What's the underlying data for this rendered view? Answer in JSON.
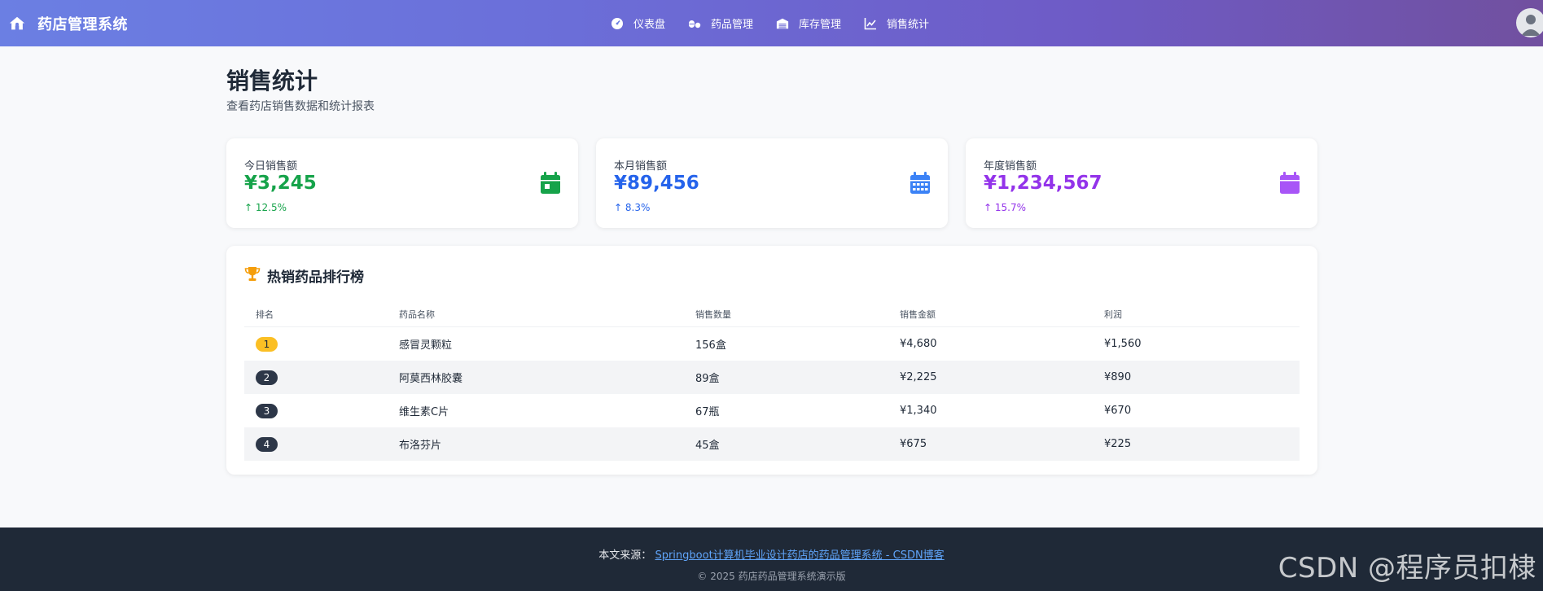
{
  "app": {
    "title": "药店管理系统"
  },
  "nav": {
    "items": [
      {
        "label": "仪表盘",
        "icon": "dashboard-icon"
      },
      {
        "label": "药品管理",
        "icon": "pills-icon"
      },
      {
        "label": "库存管理",
        "icon": "warehouse-icon"
      },
      {
        "label": "销售统计",
        "icon": "chart-line-icon"
      }
    ]
  },
  "page": {
    "title": "销售统计",
    "subtitle": "查看药店销售数据和统计报表"
  },
  "stats": [
    {
      "label": "今日销售额",
      "value": "¥3,245",
      "change": "↑ 12.5%",
      "color": "#16a34a",
      "icon": "calendar-day-icon"
    },
    {
      "label": "本月销售额",
      "value": "¥89,456",
      "change": "↑ 8.3%",
      "color": "#2563eb",
      "icon": "calendar-month-icon"
    },
    {
      "label": "年度销售额",
      "value": "¥1,234,567",
      "change": "↑ 15.7%",
      "color": "#9333ea",
      "icon": "calendar-year-icon"
    }
  ],
  "ranking": {
    "title": "热销药品排行榜",
    "columns": [
      "排名",
      "药品名称",
      "销售数量",
      "销售金额",
      "利润"
    ],
    "rows": [
      {
        "rank": "1",
        "name": "感冒灵颗粒",
        "qty": "156盒",
        "amount": "¥4,680",
        "profit": "¥1,560"
      },
      {
        "rank": "2",
        "name": "阿莫西林胶囊",
        "qty": "89盒",
        "amount": "¥2,225",
        "profit": "¥890"
      },
      {
        "rank": "3",
        "name": "维生素C片",
        "qty": "67瓶",
        "amount": "¥1,340",
        "profit": "¥670"
      },
      {
        "rank": "4",
        "name": "布洛芬片",
        "qty": "45盒",
        "amount": "¥675",
        "profit": "¥225"
      }
    ]
  },
  "footer": {
    "source_label": "本文来源：",
    "source_link": "Springboot计算机毕业设计药店的药品管理系统 - CSDN博客",
    "copyright": "© 2025 药店药品管理系统演示版",
    "watermark": "CSDN @程序员扣棣"
  },
  "colors": {
    "accent_gold": "#fbbf24",
    "badge_dark": "#2d3748",
    "footer_bg": "#1f2937",
    "link": "#60a5fa"
  }
}
